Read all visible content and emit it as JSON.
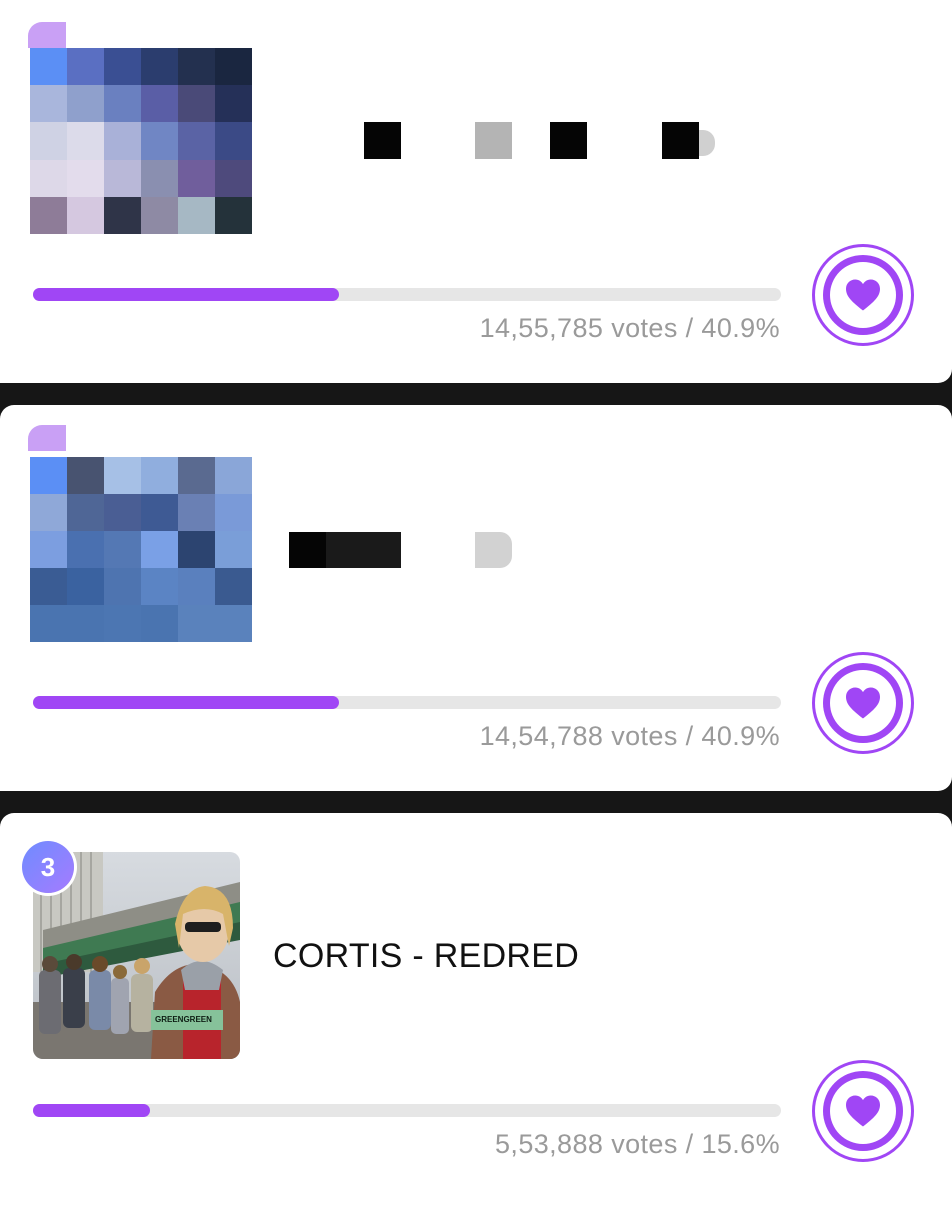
{
  "colors": {
    "accent": "#a046f5",
    "track": "#e6e6e6",
    "background": "#161616"
  },
  "entries": [
    {
      "rank": "",
      "title": "",
      "votes_text": "14,55,785 votes / 40.9%",
      "percent": 40.9,
      "thumbnail": "pixelated-artwork",
      "icon": "heart-icon"
    },
    {
      "rank": "",
      "title": "",
      "votes_text": "14,54,788 votes / 40.9%",
      "percent": 40.9,
      "thumbnail": "pixelated-artwork",
      "icon": "heart-icon"
    },
    {
      "rank": "3",
      "title": "CORTIS - REDRED",
      "votes_text": "5,53,888 votes / 15.6%",
      "percent": 15.6,
      "thumbnail": "album-cover-photo",
      "icon": "heart-icon"
    }
  ]
}
